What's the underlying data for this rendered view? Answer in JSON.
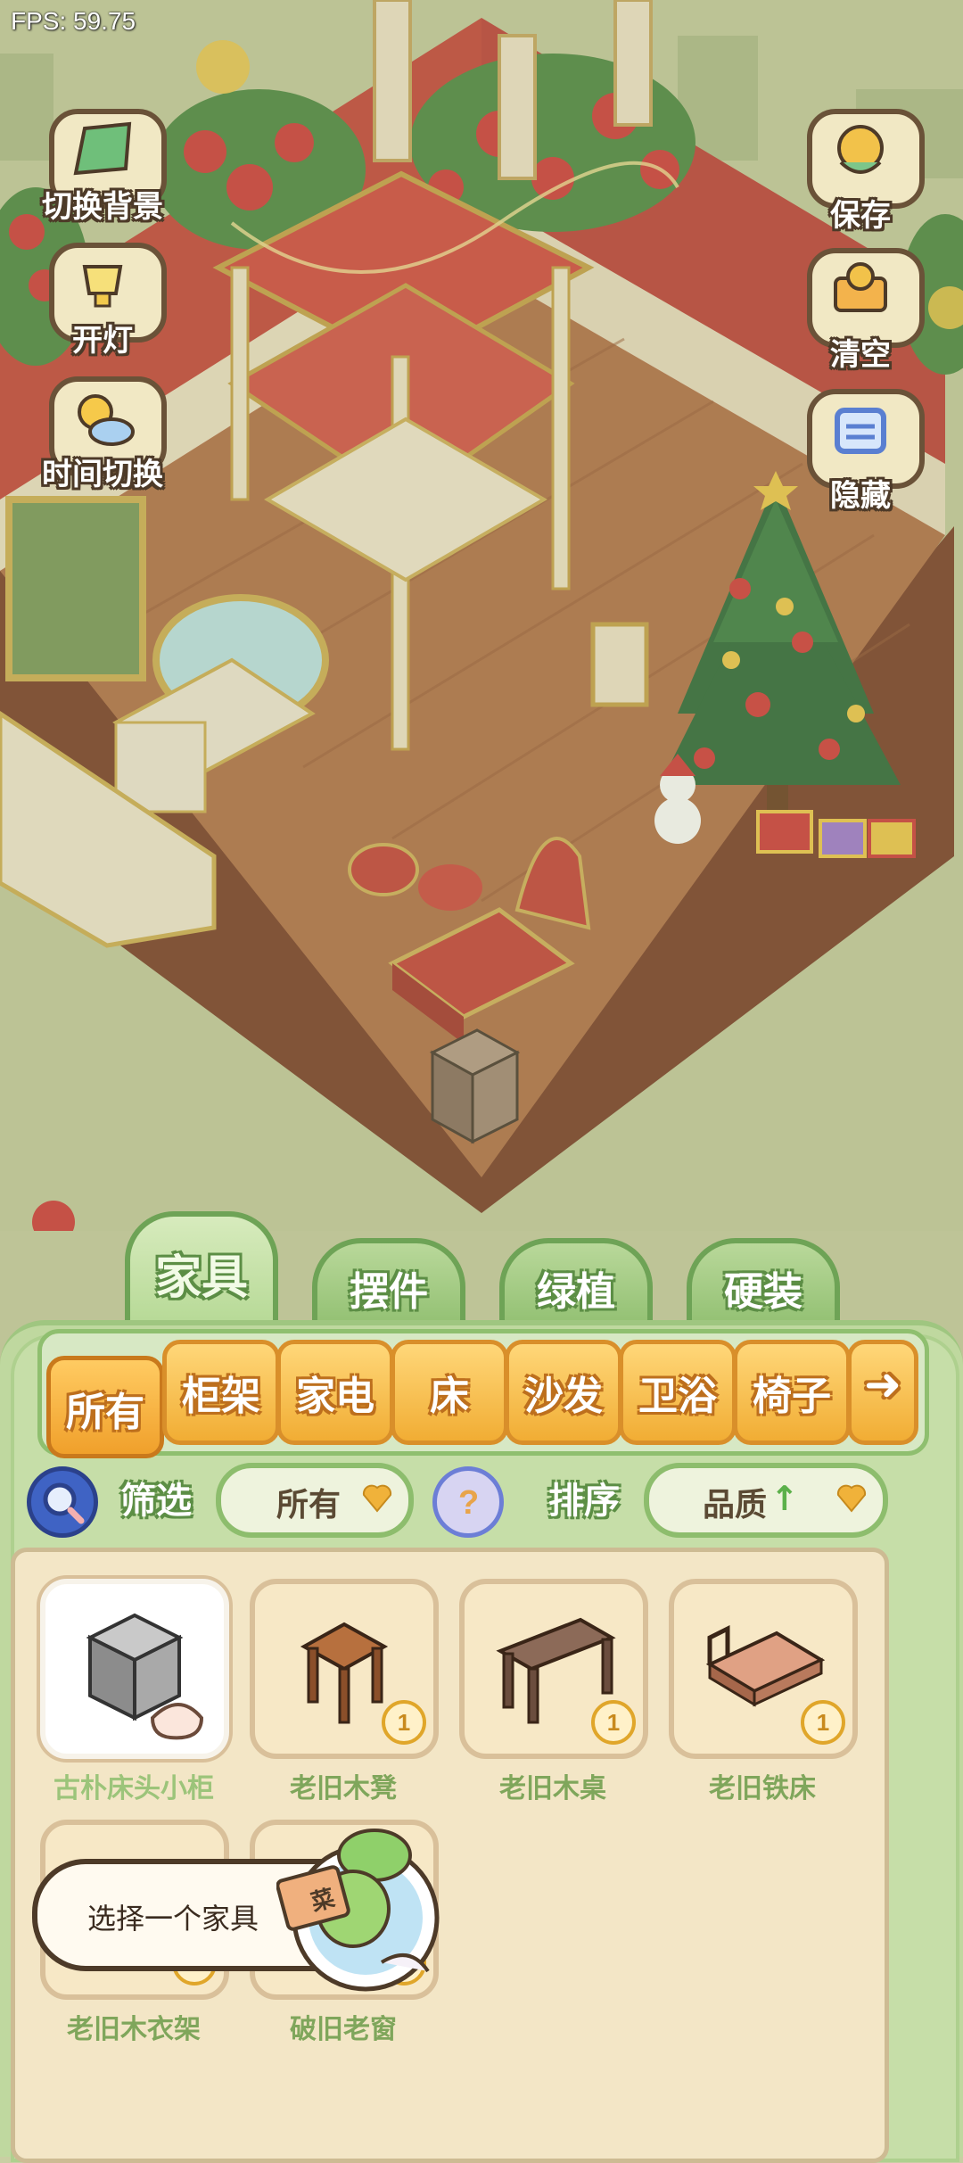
{
  "fps_text": "FPS: 59.75",
  "left_tools": [
    {
      "label": "切换背景",
      "icon": "background-swap-icon"
    },
    {
      "label": "开灯",
      "icon": "lamp-icon"
    },
    {
      "label": "时间切换",
      "icon": "sun-cloud-icon"
    }
  ],
  "right_tools": [
    {
      "label": "保存",
      "icon": "duck-save-icon"
    },
    {
      "label": "清空",
      "icon": "duck-clear-icon"
    },
    {
      "label": "隐藏",
      "icon": "hide-frame-icon"
    }
  ],
  "category_tabs": [
    {
      "label": "家具",
      "active": true
    },
    {
      "label": "摆件",
      "active": false
    },
    {
      "label": "绿植",
      "active": false
    },
    {
      "label": "硬装",
      "active": false
    }
  ],
  "sub_tabs": [
    "所有",
    "柜架",
    "家电",
    "床",
    "沙发",
    "卫浴",
    "椅子"
  ],
  "sub_tab_next_icon": "➜",
  "filter": {
    "label": "筛选",
    "value": "所有",
    "sort_label": "排序",
    "sort_value": "品质",
    "sort_arrow": "↑"
  },
  "items": [
    {
      "name": "古朴床头小柜",
      "count": null,
      "selected": true
    },
    {
      "name": "老旧木凳",
      "count": "1"
    },
    {
      "name": "老旧木桌",
      "count": "1"
    },
    {
      "name": "老旧铁床",
      "count": "1"
    },
    {
      "name": "老旧木衣架",
      "count": "1"
    },
    {
      "name": "破旧老窗",
      "count": "1"
    }
  ],
  "tip_text": "选择一个家具",
  "book_text": "菜",
  "colors": {
    "panel_green": "#bfd89f",
    "tab_orange": "#f1ad34",
    "room_red": "#c8463c",
    "floor_wood": "#a9623c"
  }
}
